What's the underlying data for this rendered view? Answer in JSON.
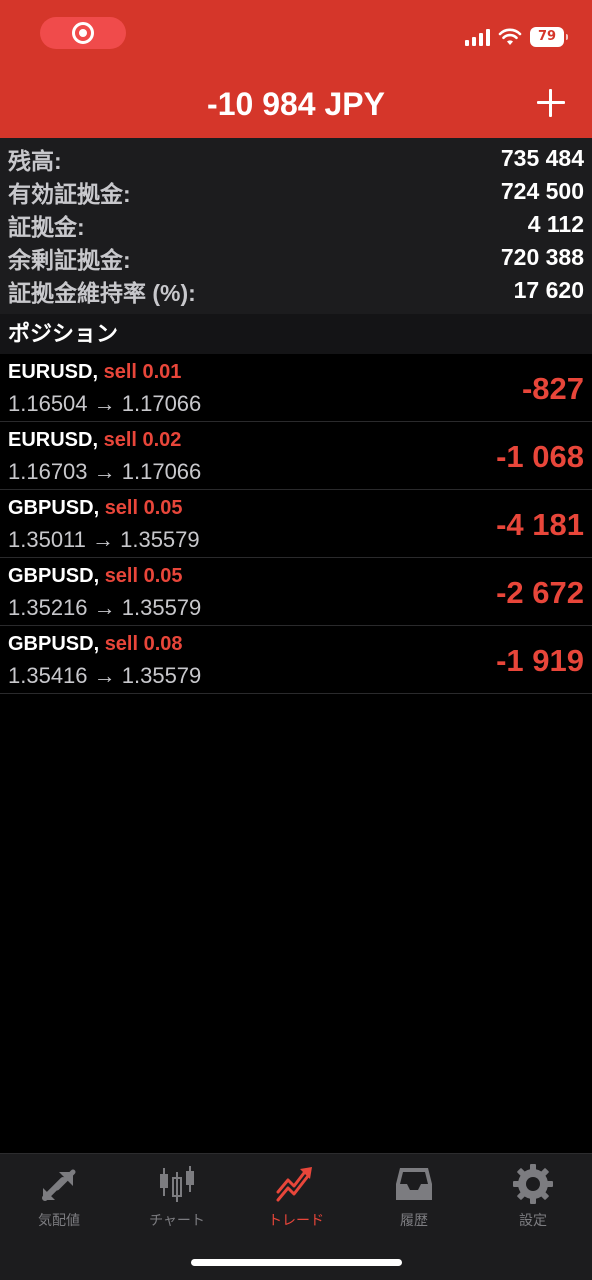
{
  "header": {
    "balance_title": "-10 984 JPY",
    "battery_level": "79",
    "accent_color": "#d5362a"
  },
  "summary": {
    "rows": [
      {
        "label": "残高:",
        "value": "735 484"
      },
      {
        "label": "有効証拠金:",
        "value": "724 500"
      },
      {
        "label": "証拠金:",
        "value": "4 112"
      },
      {
        "label": "余剰証拠金:",
        "value": "720 388"
      },
      {
        "label": "証拠金維持率 (%):",
        "value": "17 620"
      }
    ]
  },
  "positions": {
    "section_title": "ポジション",
    "items": [
      {
        "symbol": "EURUSD,",
        "side": "sell 0.01",
        "prices": "1.16504 → 1.17066",
        "profit": "-827"
      },
      {
        "symbol": "EURUSD,",
        "side": "sell 0.02",
        "prices": "1.16703 → 1.17066",
        "profit": "-1 068"
      },
      {
        "symbol": "GBPUSD,",
        "side": "sell 0.05",
        "prices": "1.35011 → 1.35579",
        "profit": "-4 181"
      },
      {
        "symbol": "GBPUSD,",
        "side": "sell 0.05",
        "prices": "1.35216 → 1.35579",
        "profit": "-2 672"
      },
      {
        "symbol": "GBPUSD,",
        "side": "sell 0.08",
        "prices": "1.35416 → 1.35579",
        "profit": "-1 919"
      }
    ]
  },
  "tabbar": {
    "tabs": [
      {
        "label": "気配値",
        "icon": "quotes-arrows-icon"
      },
      {
        "label": "チャート",
        "icon": "candlestick-chart-icon"
      },
      {
        "label": "トレード",
        "icon": "trade-trend-icon"
      },
      {
        "label": "履歴",
        "icon": "history-tray-icon"
      },
      {
        "label": "設定",
        "icon": "gear-icon"
      }
    ],
    "active_index": 2,
    "active_color": "#e8463a",
    "inactive_color": "#7c7c80"
  }
}
